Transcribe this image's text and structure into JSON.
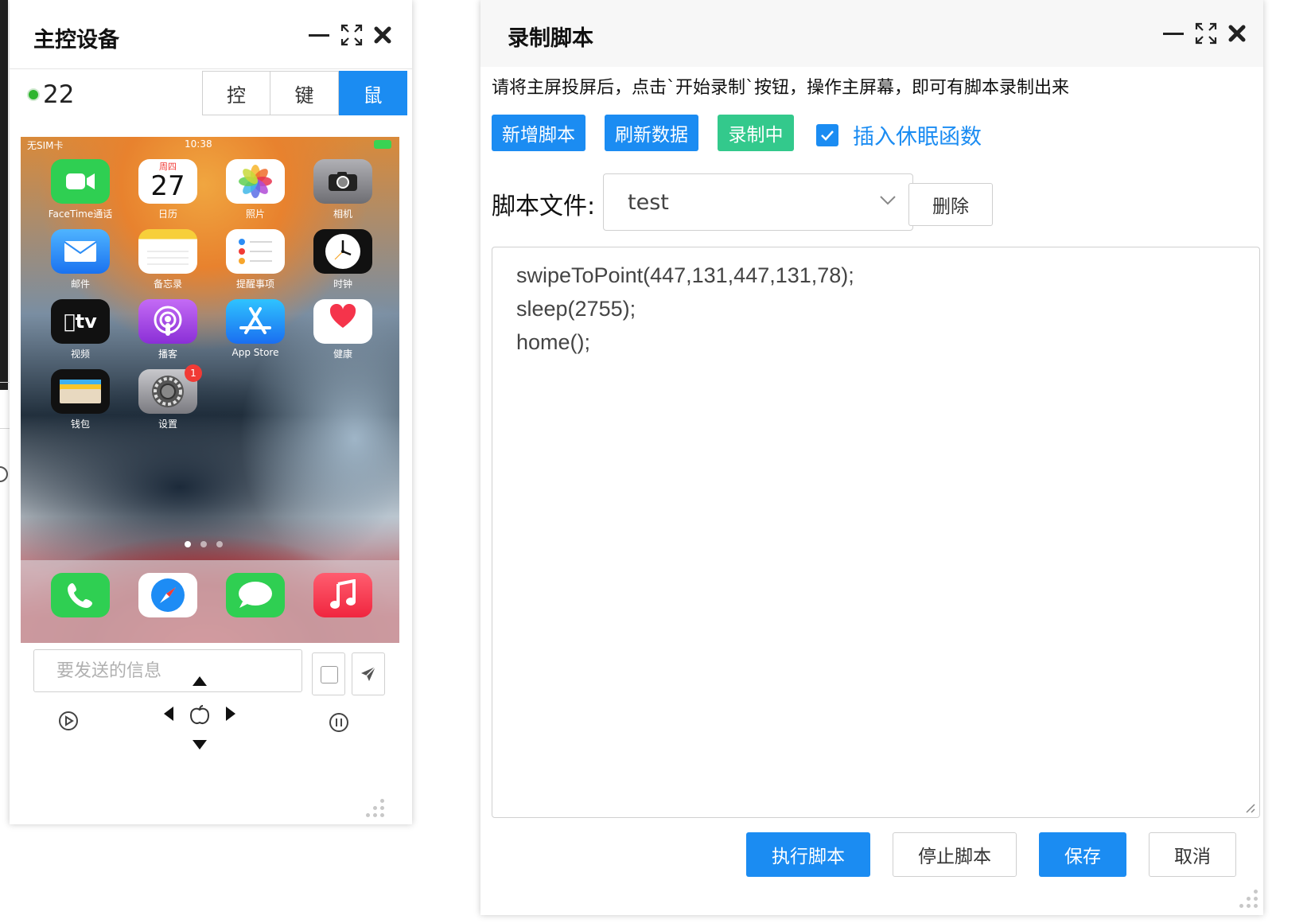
{
  "left_window": {
    "title": "主控设备",
    "device_count": "22",
    "tabs": [
      "控",
      "键",
      "鼠"
    ],
    "active_tab": "鼠",
    "phone": {
      "carrier": "无SIM卡",
      "time": "10:38",
      "calendar_weekday": "周四",
      "calendar_day": "27",
      "badge_settings": "1",
      "apps": [
        {
          "label": "FaceTime通话",
          "icon": "facetime-icon",
          "color": "#2fcf52"
        },
        {
          "label": "日历",
          "icon": "calendar-icon",
          "color": "#ffffff"
        },
        {
          "label": "照片",
          "icon": "photos-icon",
          "color": "#ffffff"
        },
        {
          "label": "相机",
          "icon": "camera-icon",
          "color": "#8e8e93"
        },
        {
          "label": "邮件",
          "icon": "mail-icon",
          "color": "#2c8df5"
        },
        {
          "label": "备忘录",
          "icon": "notes-icon",
          "color": "#ffffff"
        },
        {
          "label": "提醒事项",
          "icon": "reminders-icon",
          "color": "#ffffff"
        },
        {
          "label": "时钟",
          "icon": "clock-icon",
          "color": "#111111"
        },
        {
          "label": "视频",
          "icon": "appletv-icon",
          "color": "#111111"
        },
        {
          "label": "播客",
          "icon": "podcasts-icon",
          "color": "#a04be8"
        },
        {
          "label": "App Store",
          "icon": "appstore-icon",
          "color": "#1d8cf5"
        },
        {
          "label": "健康",
          "icon": "health-icon",
          "color": "#ffffff"
        },
        {
          "label": "钱包",
          "icon": "wallet-icon",
          "color": "#111111"
        },
        {
          "label": "设置",
          "icon": "settings-icon",
          "color": "#8e8e93"
        }
      ],
      "dock": [
        {
          "icon": "phone-icon",
          "color": "#2fcf52"
        },
        {
          "icon": "safari-icon",
          "color": "#ffffff"
        },
        {
          "icon": "messages-icon",
          "color": "#2fcf52"
        },
        {
          "icon": "music-icon",
          "color": "#f5344b"
        }
      ]
    },
    "message_placeholder": "要发送的信息"
  },
  "right_window": {
    "title": "录制脚本",
    "hint": "请将主屏投屏后，点击`开始录制`按钮，操作主屏幕，即可有脚本录制出来",
    "buttons": {
      "add_script": "新增脚本",
      "refresh": "刷新数据",
      "recording": "录制中",
      "delete": "删除",
      "run": "执行脚本",
      "stop": "停止脚本",
      "save": "保存",
      "cancel": "取消"
    },
    "insert_sleep_label": "插入休眠函数",
    "insert_sleep_checked": true,
    "script_file_label": "脚本文件:",
    "script_file_value": "test",
    "code_lines": [
      "swipeToPoint(447,131,447,131,78);",
      "sleep(2755);",
      "home();"
    ]
  },
  "colors": {
    "accent_blue": "#1b8cf2",
    "recording_green": "#33c98c",
    "online_green": "#2fb52f"
  }
}
